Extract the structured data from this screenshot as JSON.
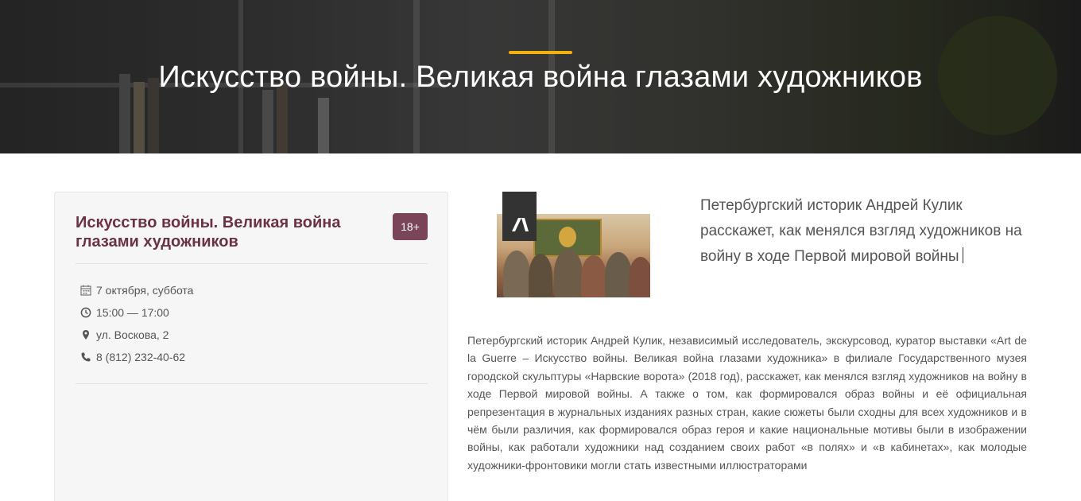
{
  "hero": {
    "title": "Искусство войны. Великая война глазами художников",
    "accent_color": "#f2b10c"
  },
  "event": {
    "title": "Искусство войны. Великая война глазами художников",
    "age_rating": "18+",
    "date": "7 октября, суббота",
    "time": "15:00 — 17:00",
    "address": "ул. Воскова, 2",
    "phone": "8 (812) 232-40-62",
    "title_color": "#6b3146",
    "badge_color": "#7b4559"
  },
  "lead": "Петербургский историк Андрей Кулик расскажет, как менялся взгляд художников на войну в ходе Первой мировой войны",
  "description": "Петербургский историк Андрей Кулик, независимый исследователь, экскурсовод, куратор выставки «Art de la Guerre – Искусство войны. Великая война глазами художника» в филиале Государственного музея городской скульптуры «Нарвские ворота» (2018 год), расскажет, как менялся взгляд художников на войну в ходе Первой мировой войны. А также о том, как формировался образ войны и её официальная репрезентация в журнальных изданиях разных стран, какие сюжеты были сходны для всех художников и в чём были различия, как формировался образ героя и какие национальные мотивы были в изображении войны, как работали художники над созданием своих работ «в полях» и «в кабинетах», как молодые художники-фронтовики могли стать известными иллюстраторами",
  "icons": [
    "calendar-icon",
    "clock-icon",
    "map-pin-icon",
    "phone-icon",
    "logo-icon"
  ]
}
